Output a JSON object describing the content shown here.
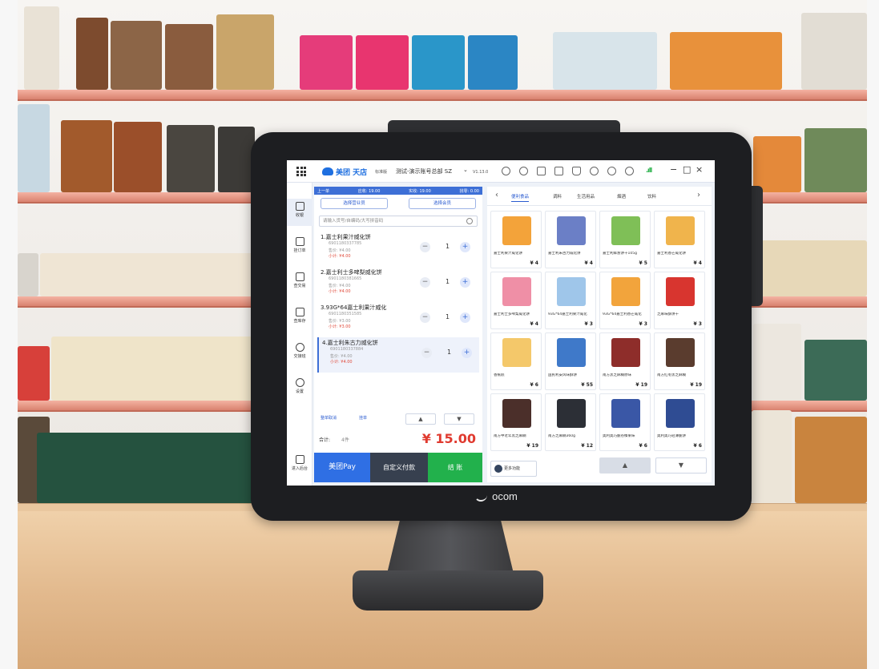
{
  "app": {
    "logo_text": "美团 天店",
    "logo_sub": "标准版",
    "store_name": "测试-演示账号总部 SZ",
    "version": "V1.13.0"
  },
  "window": {
    "minimize": "−",
    "maximize": "□",
    "close": "×"
  },
  "nav": [
    {
      "label": "收银",
      "icon": "cashier-icon"
    },
    {
      "label": "挂订单",
      "icon": "order-icon"
    },
    {
      "label": "查交易",
      "icon": "transaction-icon"
    },
    {
      "label": "查库存",
      "icon": "inventory-icon"
    },
    {
      "label": "交接班",
      "icon": "shift-icon"
    },
    {
      "label": "设置",
      "icon": "settings-icon"
    },
    {
      "label": "进入后台",
      "icon": "backend-icon"
    }
  ],
  "order": {
    "header": [
      "上一单",
      "应收: 19.00",
      "实收: 19.00",
      "找零: 0.00"
    ],
    "select_staff": "选择营业员",
    "select_member": "选择会员",
    "search_placeholder": "请输入货号/自编码/大写拼音码",
    "items": [
      {
        "name": "1.嘉士利果汁威化饼",
        "code": "6901180337785",
        "price": "售价: ¥4.00",
        "subtotal": "小计: ¥4.00",
        "qty": "1"
      },
      {
        "name": "2.嘉士利士多啤梨威化饼",
        "code": "6901180381665",
        "price": "售价: ¥4.00",
        "subtotal": "小计: ¥4.00",
        "qty": "1"
      },
      {
        "name": "3.93G*64嘉士利果汁威化",
        "code": "6901180351585",
        "price": "售价: ¥3.00",
        "subtotal": "小计: ¥3.00",
        "qty": "1"
      },
      {
        "name": "4.嘉士利朱古力威化饼",
        "code": "6901180337884",
        "price": "售价: ¥4.00",
        "subtotal": "小计: ¥4.00",
        "qty": "1"
      }
    ],
    "clear_label": "整单取消",
    "hold_label": "挂单",
    "total_label": "合计:",
    "total_count": "4件",
    "total_value": "¥ 15.00",
    "pay_meituan": "美团Pay",
    "pay_custom": "自定义付款",
    "pay_checkout": "结 账"
  },
  "catalog": {
    "tabs": [
      "便利食品",
      "调料",
      "生活用品",
      "烟酒",
      "饮料"
    ],
    "more_label": "更多功能",
    "products": [
      {
        "name": "嘉士利果汁威化饼",
        "price": "¥ 4",
        "color": "#f3a33a"
      },
      {
        "name": "嘉士利朱古力威化饼",
        "price": "¥ 4",
        "color": "#6b7fc6"
      },
      {
        "name": "嘉士利鲜葱饼干105g",
        "price": "¥ 5",
        "color": "#7fbf57"
      },
      {
        "name": "嘉士利香芒威化饼",
        "price": "¥ 4",
        "color": "#f0b44c"
      },
      {
        "name": "嘉士利士多啤梨威化饼",
        "price": "¥ 4",
        "color": "#ef8fa6"
      },
      {
        "name": "93G*64嘉士利果汁威化",
        "price": "¥ 3",
        "color": "#9fc6ea"
      },
      {
        "name": "93G*64嘉士利香芒威化",
        "price": "¥ 3",
        "color": "#f2a43c"
      },
      {
        "name": "芝麻味酥饼干",
        "price": "¥ 3",
        "color": "#d8352f"
      },
      {
        "name": "香蕉糕",
        "price": "¥ 6",
        "color": "#f4c86a"
      },
      {
        "name": "国民利安风味酥饼",
        "price": "¥ 55",
        "color": "#3f79c9"
      },
      {
        "name": "南方黑芝麻糊原味",
        "price": "¥ 19",
        "color": "#8e2d2a"
      },
      {
        "name": "南方红枣黑芝麻糊",
        "price": "¥ 19",
        "color": "#5a3c2e"
      },
      {
        "name": "南方中老年黑芝麻糊",
        "price": "¥ 19",
        "color": "#4b2f2a"
      },
      {
        "name": "南方芝麻糊360g",
        "price": "¥ 12",
        "color": "#2c2f36"
      },
      {
        "name": "奥利奥巧脆卷榛果味",
        "price": "¥ 6",
        "color": "#3a57a6"
      },
      {
        "name": "奥利奥巧轻薄脆饼",
        "price": "¥ 6",
        "color": "#2f4c93"
      }
    ]
  },
  "brand": "ocom",
  "colors": {
    "accent": "#2f6fe4",
    "checkout": "#22b14c",
    "total": "#e03a2f",
    "signal": "#2bb24c"
  }
}
